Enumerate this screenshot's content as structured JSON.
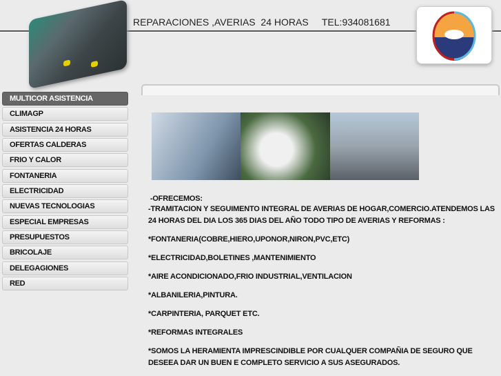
{
  "header": {
    "title": "REPARACIONES ,AVERIAS  24 HORAS",
    "phone": "TEL:934081681"
  },
  "nav": {
    "items": [
      "MULTICOR ASISTENCIA",
      "CLIMAGP",
      "ASISTENCIA 24 HORAS",
      "OFERTAS CALDERAS",
      "FRIO Y CALOR",
      "FONTANERIA",
      "ELECTRICIDAD",
      "NUEVAS TECNOLOGIAS",
      "ESPECIAL EMPRESAS",
      "PRESUPUESTOS",
      "BRICOLAJE",
      "DELEGAGIONES",
      "RED"
    ],
    "active": 0
  },
  "content": {
    "intro": " -OFRECEMOS:",
    "lead": "-TRAMITACION Y SEGUIMENTO INTEGRAL DE AVERIAS DE HOGAR,COMERCIO.ATENDEMOS LAS 24 HORAS DEL DIA LOS 365 DIAS DEL AÑO TODO TIPO DE AVERIAS Y REFORMAS :",
    "services": [
      "*FONTANERIA(COBRE,HIERO,UPONOR,NIRON,PVC,ETC)",
      "*ELECTRICIDAD,BOLETINES ,MANTENIMIENTO",
      "*AIRE ACONDICIONADO,FRIO INDUSTRIAL,VENTILACION",
      "*ALBANILERIA,PINTURA.",
      "*CARPINTERIA, PARQUET  ETC.",
      "*REFORMAS INTEGRALES"
    ],
    "closing": "*SOMOS LA HERAMIENTA IMPRESCINDIBLE POR CUALQUER COMPAÑIA DE SEGURO QUE DESEEA DAR UN BUEN  E COMPLETO SERVICIO A SUS ASEGURADOS."
  }
}
